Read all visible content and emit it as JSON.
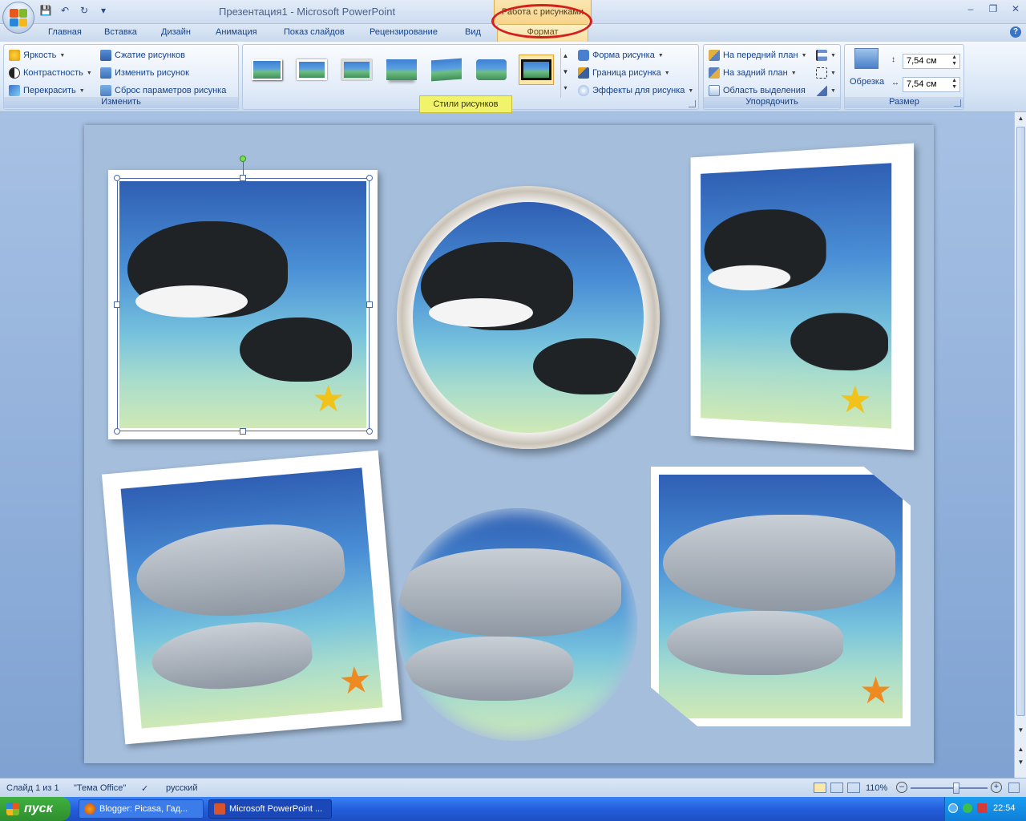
{
  "window": {
    "title": "Презентация1 - Microsoft PowerPoint",
    "context_group": "Работа с рисунками"
  },
  "tabs": [
    "Главная",
    "Вставка",
    "Дизайн",
    "Анимация",
    "Показ слайдов",
    "Рецензирование",
    "Вид"
  ],
  "active_tab": "Формат",
  "ribbon": {
    "adjust": {
      "label": "Изменить",
      "brightness": "Яркость",
      "contrast": "Контрастность",
      "recolor": "Перекрасить",
      "compress": "Сжатие рисунков",
      "change": "Изменить рисунок",
      "reset": "Сброс параметров рисунка"
    },
    "styles": {
      "label": "Стили рисунков",
      "shape": "Форма рисунка",
      "border": "Граница рисунка",
      "effects": "Эффекты для рисунка"
    },
    "arrange": {
      "label": "Упорядочить",
      "front": "На передний план",
      "back": "На задний план",
      "selection_pane": "Область выделения"
    },
    "size": {
      "label": "Размер",
      "crop": "Обрезка",
      "height": "7,54 см",
      "width": "7,54 см"
    }
  },
  "tooltip": "Стили рисунков",
  "status": {
    "slide": "Слайд 1 из 1",
    "theme": "\"Тема Office\"",
    "language": "русский",
    "zoom": "110%",
    "zoom_level": 0.6
  },
  "taskbar": {
    "start": "пуск",
    "item1": "Blogger: Picasa, Гад...",
    "item2": "Microsoft PowerPoint ...",
    "time": "22:54"
  },
  "colors": {
    "accent": "#15428b",
    "highlight": "#d41f1f",
    "tooltip": "#f1f36a"
  }
}
